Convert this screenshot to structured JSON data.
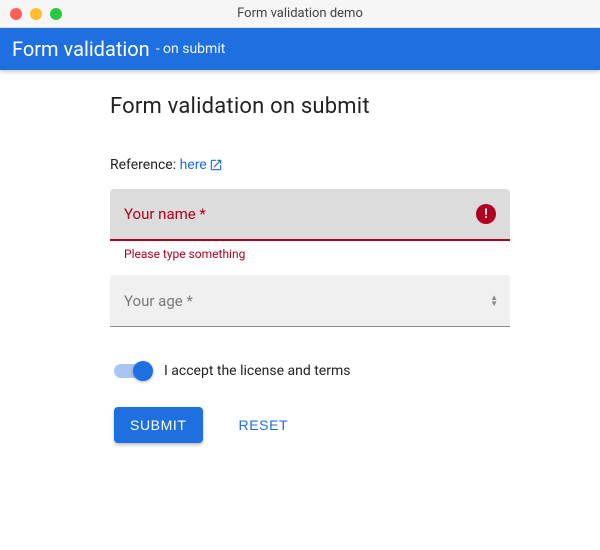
{
  "window": {
    "title": "Form validation demo"
  },
  "appbar": {
    "title": "Form validation",
    "subtitle": "- on submit"
  },
  "page": {
    "heading": "Form validation on submit",
    "reference_label": "Reference: ",
    "reference_link_text": "here"
  },
  "form": {
    "name": {
      "placeholder": "Your name *",
      "error_message": "Please type something"
    },
    "age": {
      "placeholder": "Your age *"
    },
    "terms": {
      "label": "I accept the license and terms",
      "checked": true
    },
    "buttons": {
      "submit": "Submit",
      "reset": "Reset"
    }
  },
  "colors": {
    "primary": "#1e6fe0",
    "error": "#b00020"
  }
}
